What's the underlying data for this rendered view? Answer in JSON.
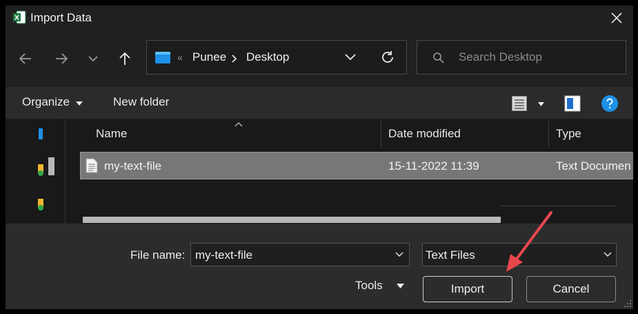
{
  "window": {
    "title": "Import Data"
  },
  "address_bar": {
    "overflow_glyph": "«",
    "crumbs": [
      "Punee",
      "Desktop"
    ]
  },
  "search": {
    "placeholder": "Search Desktop"
  },
  "toolbar": {
    "organize_label": "Organize",
    "new_folder_label": "New folder"
  },
  "columns": {
    "name": "Name",
    "date_modified": "Date modified",
    "type": "Type"
  },
  "files": [
    {
      "name": "my-text-file",
      "date_modified": "15-11-2022 11:39",
      "type": "Text Documen"
    }
  ],
  "bottom": {
    "file_name_label": "File name:",
    "file_name_value": "my-text-file",
    "file_type_value": "Text Files",
    "tools_label": "Tools",
    "import_label": "Import",
    "cancel_label": "Cancel"
  },
  "colors": {
    "annotation_arrow": "#e8474e",
    "accent_blue": "#1e90e6",
    "excel_green": "#1d7a45"
  }
}
